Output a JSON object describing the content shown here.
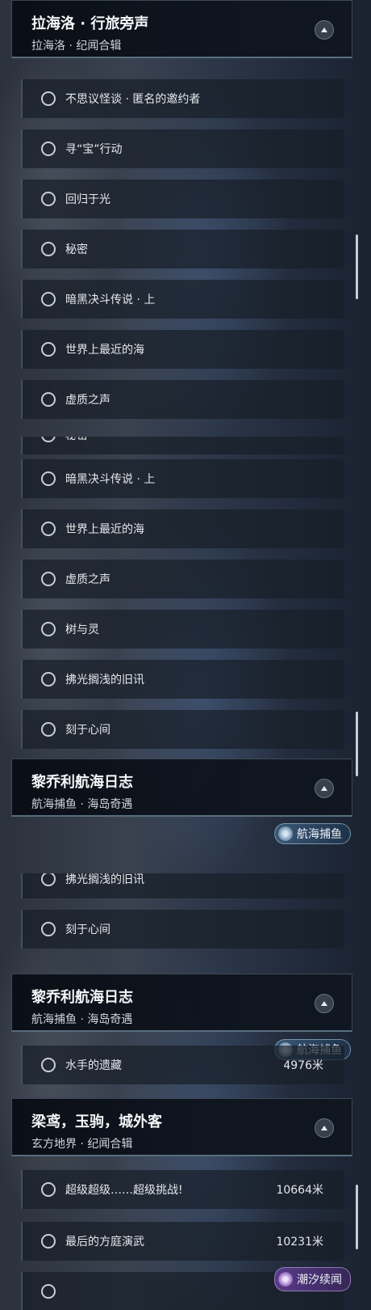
{
  "sections": {
    "lahailo": {
      "title": "拉海洛 · 行旅旁声",
      "subtitle": "拉海洛 · 纪闻合辑"
    },
    "liqiaoli": {
      "title": "黎乔利航海日志",
      "subtitle": "航海捕鱼 · 海岛奇遇"
    },
    "liangyuan": {
      "title": "梁鸢，玉驹，城外客",
      "subtitle": "玄方地界 · 纪闻合辑"
    }
  },
  "quests": {
    "q1": "不思议怪谈 · 匿名的邀约者",
    "q2": "寻“宝”行动",
    "q3": "回归于光",
    "q4": "秘密",
    "q5": "暗黑决斗传说 · 上",
    "q6": "世界上最近的海",
    "q7": "虚质之声",
    "q8": "树与灵",
    "q9": "拂光搁浅的旧讯",
    "q10": "刻于心间",
    "q11": "水手的遗藏",
    "q12": "超级超级……超级挑战!",
    "q13": "最后的方庭演武"
  },
  "distances": {
    "q11": "4976米",
    "q12": "10664米",
    "q13": "10231米"
  },
  "tags": {
    "fishing": "航海捕鱼",
    "tide": "潮汐续闻"
  },
  "icons": {
    "collapse": "chevron-up-icon",
    "status": "empty-circle-icon",
    "fishing": "fishing-badge-icon",
    "tide": "tide-badge-icon"
  }
}
